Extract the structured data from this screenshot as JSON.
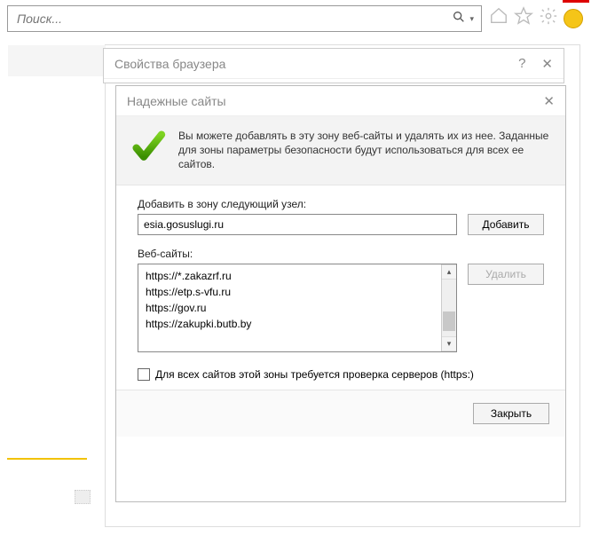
{
  "search": {
    "placeholder": "Поиск..."
  },
  "parentDialog": {
    "title": "Свойства браузера"
  },
  "childDialog": {
    "title": "Надежные сайты",
    "infoText": "Вы можете добавлять в эту зону  веб-сайты и удалять их из нее. Заданные для зоны параметры безопасности будут использоваться для всех ее сайтов.",
    "addLabel": "Добавить в зону следующий узел:",
    "addValue": "esia.gosuslugi.ru",
    "addButton": "Добавить",
    "listLabel": "Веб-сайты:",
    "removeButton": "Удалить",
    "sites": [
      "https://*.zakazrf.ru",
      "https://etp.s-vfu.ru",
      "https://gov.ru",
      "https://zakupki.butb.by"
    ],
    "httpsCheckLabel": "Для всех сайтов этой зоны требуется проверка серверов (https:)",
    "httpsChecked": false,
    "closeButton": "Закрыть"
  }
}
